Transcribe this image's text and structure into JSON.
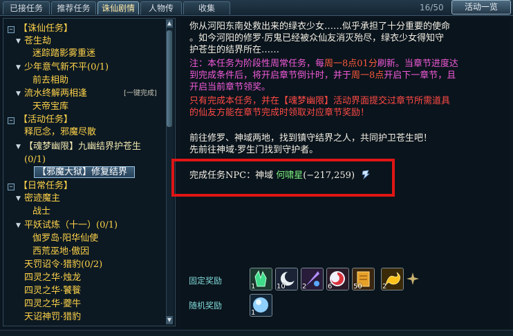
{
  "tabs": [
    {
      "label": "已接任务"
    },
    {
      "label": "推荐任务"
    },
    {
      "label": "诛仙剧情"
    },
    {
      "label": "人物传"
    },
    {
      "label": "收集"
    }
  ],
  "counter": "16/50",
  "activity_button": "活动一览",
  "quest_list": {
    "cat_zhuxian": "【诛仙任务】",
    "sub_cangshengjie": "苍生劫",
    "q_milu": "迷踪踏影雾重迷",
    "sub_shaonian": "少年意气新不平",
    "sub_shaonian_count": "(0/1)",
    "q_qianqu": "前去相助",
    "sub_liushui": "流水终解两相逢",
    "one_click": "[一键完成]",
    "q_tiandi": "天帝宝库",
    "cat_huodong": "【活动任务】",
    "q_shiezhi": "释厄念，邪魔尽散",
    "sub_hunmeng": "【魂梦幽限】九幽结界护苍生",
    "sub_hunmeng_count": "(0/1)",
    "q_xiemo": "【邪魔大狱】修复结界",
    "cat_richang": "【日常任务】",
    "sub_mijing": "密迹魔主",
    "q_zhanshi": "战士",
    "sub_pingyao": "平妖试炼（十一）",
    "sub_pingyao_count": "(0/1)",
    "q_jialuo": "伽罗岛·阳华仙使",
    "q_xihuang": "西荒巫地·傲因",
    "q_tianfa": "天罚诏令·猎豹",
    "q_tianfa_count": "(0/2)",
    "q_siling1": "四灵之华·烛龙",
    "q_siling2": "四灵之华·饕餮",
    "q_siling3": "四灵之华·夔牛",
    "q_tianzhao": "天诏神罚·猎豹"
  },
  "detail": {
    "intro_1": "你从河阳东南处救出来的绿衣少女……似乎承担了十分重要的使命",
    "intro_2": "。如今河阳的修罗·厉鬼已经被众仙友消灭殆尽，绿衣少女得知守",
    "intro_3": "护苍生的结界所在……",
    "note_1a": "注：本任务为阶段性周常任务，每",
    "note_1b": "周一8点01分",
    "note_1c": "刷新。当章节进度达",
    "note_2a": "到完成条件后，将开启章节倒计时，并于",
    "note_2b": "周一8点",
    "note_2c": "开启下一章节，且",
    "note_3": "开启当前章节领奖。",
    "warn_1": "只有完成本任务，并在【魂梦幽限】活动界面提交过章节所需道具",
    "warn_2": "的仙友方能在章节完成时领取对应章节奖励！",
    "goal_1": "前往修罗、神域两地，找到镇守结界之人，共同护卫苍生吧！",
    "goal_2": "先前往神域·罗生门找到守护者。",
    "npc_prefix": "完成任务NPC：神域 ",
    "npc_name": "何啸星",
    "npc_coords": "(−217,259)"
  },
  "rewards": {
    "fixed_label": "固定奖励",
    "random_label": "随机奖励",
    "fixed_items": [
      {
        "icon": "green-crystal-icon",
        "count": "1"
      },
      {
        "icon": "moon-orb-icon",
        "count": "10"
      },
      {
        "icon": "purple-feather-icon",
        "count": "2"
      },
      {
        "icon": "red-swirl-icon",
        "count": "6"
      },
      {
        "icon": "golden-token-icon",
        "count": "50"
      },
      {
        "icon": "gold-dragon-icon",
        "count": "2"
      }
    ],
    "random_items": [
      {
        "icon": "blue-pearl-icon",
        "count": "1"
      }
    ]
  },
  "colors": {
    "highlight_box": "#e01515",
    "accent_gold": "#ffd24a",
    "accent_green": "#7df07d",
    "red_text": "#ff4a45",
    "magenta_text": "#f05ad8"
  }
}
